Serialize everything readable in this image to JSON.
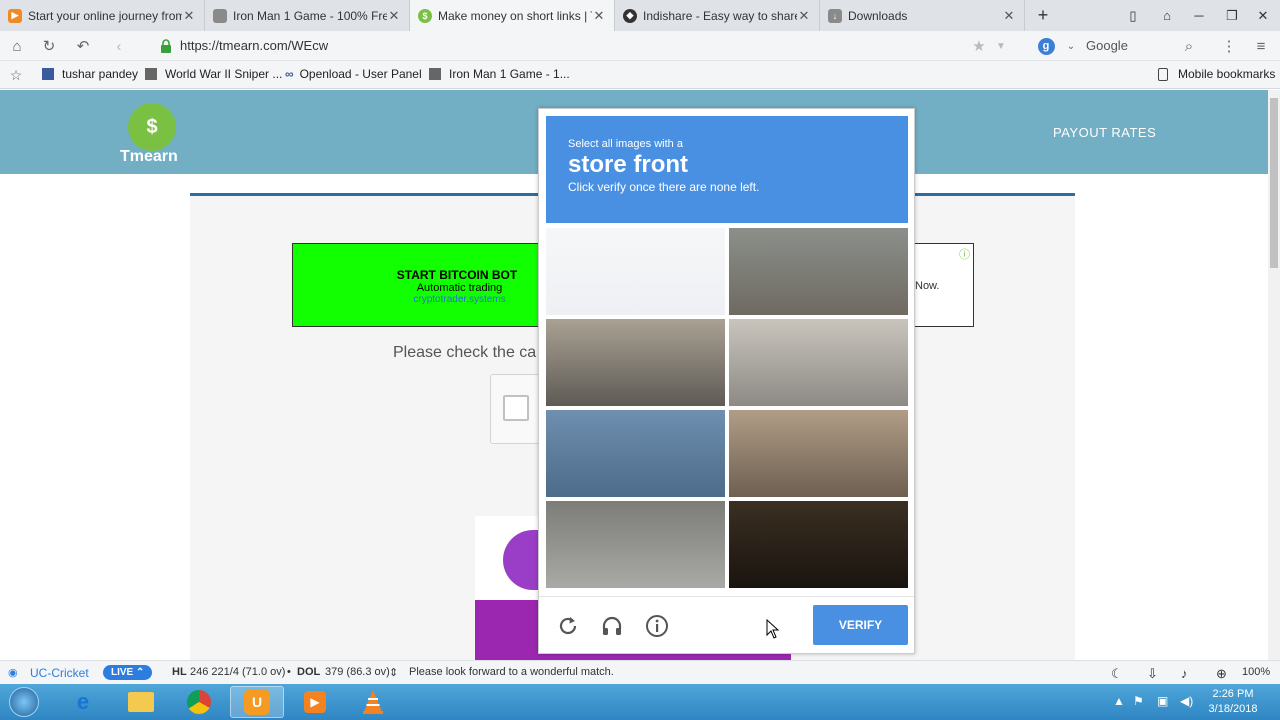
{
  "tabs": [
    {
      "title": "Start your online journey from",
      "icon_color": "#f08a24",
      "active": false
    },
    {
      "title": "Iron Man 1 Game - 100% Free",
      "icon_color": "#8a8a8a",
      "active": false
    },
    {
      "title": "Make money on short links | T",
      "icon_color": "#7ac143",
      "active": true
    },
    {
      "title": "Indishare - Easy way to share y",
      "icon_color": "#333333",
      "active": false
    },
    {
      "title": "Downloads",
      "icon_color": "#8a8a8a",
      "active": false
    }
  ],
  "address": {
    "url": "https://tmearn.com/WEcw",
    "search_engine": "Google"
  },
  "bookmarks": [
    {
      "label": "tushar pandey"
    },
    {
      "label": "World War II Sniper ..."
    },
    {
      "label": "Openload - User Panel"
    },
    {
      "label": "Iron Man 1 Game - 1..."
    }
  ],
  "mobile_bookmarks": "Mobile bookmarks",
  "site": {
    "logo_text": "Tmearn",
    "nav_payout": "PAYOUT RATES",
    "ad": {
      "title": "START BITCOIN BOT",
      "subtitle": "Automatic trading",
      "link": "cryptotrader.systems"
    },
    "ad_right_text": "Now.",
    "check_text": "Please check the ca"
  },
  "captcha": {
    "line1": "Select all images with a",
    "line2": "store front",
    "line3": "Click verify once there are none left.",
    "verify_label": "VERIFY",
    "tiles": [
      {
        "name": "blank",
        "top": "#f6f7f9",
        "bottom": "#eef0f3"
      },
      {
        "name": "planter-wall",
        "top": "#8b8f8a",
        "bottom": "#6f6a62"
      },
      {
        "name": "office-buildings",
        "top": "#a9a193",
        "bottom": "#5e5a55"
      },
      {
        "name": "stone-wall-door",
        "top": "#c9c5bd",
        "bottom": "#8d8a85"
      },
      {
        "name": "mural",
        "top": "#6f8fb0",
        "bottom": "#4d6b8a"
      },
      {
        "name": "tall-building",
        "top": "#b19d86",
        "bottom": "#6e5f52"
      },
      {
        "name": "corridor",
        "top": "#7c7c78",
        "bottom": "#a9a9a6"
      },
      {
        "name": "shop-window",
        "top": "#3a2f22",
        "bottom": "#1a140f"
      }
    ]
  },
  "status": {
    "uc_label": "UC-Cricket",
    "live": "LIVE",
    "score1_team": "HL",
    "score1": "246 221/4 (71.0 ov)",
    "score2_team": "DOL",
    "score2": "379 (86.3 ov)",
    "message": "Please look forward to a wonderful match.",
    "zoom": "100%"
  },
  "clock": {
    "time": "2:26 PM",
    "date": "3/18/2018"
  }
}
